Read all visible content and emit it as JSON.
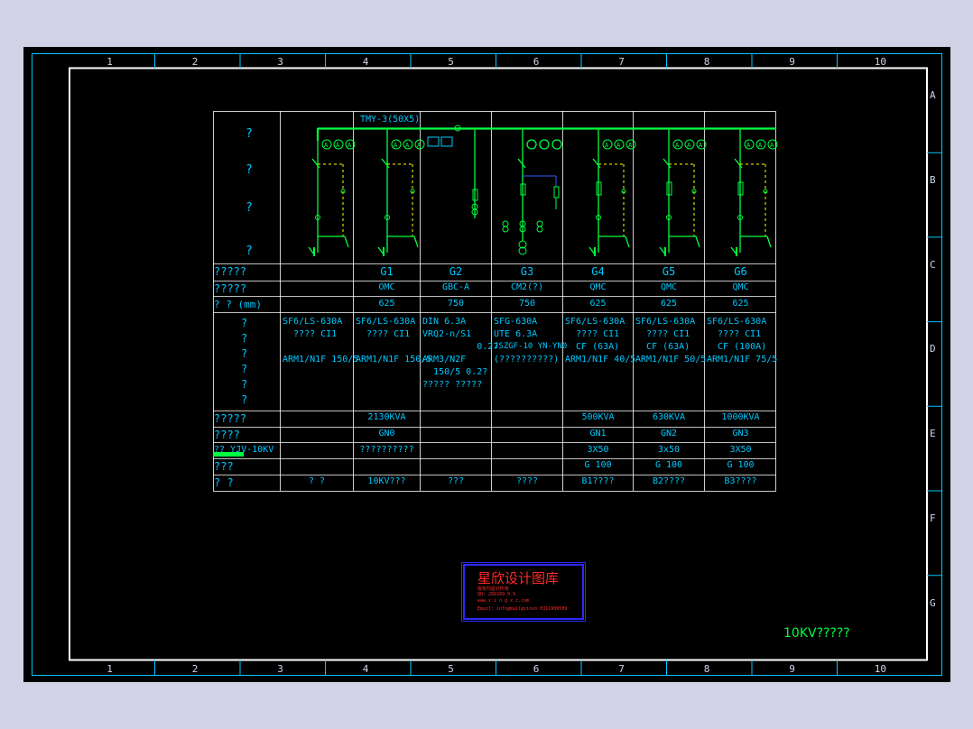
{
  "frame": {
    "columns": [
      "1",
      "2",
      "3",
      "4",
      "5",
      "6",
      "7",
      "8",
      "9",
      "10"
    ],
    "rows": [
      "A",
      "B",
      "C",
      "D",
      "E",
      "F",
      "G"
    ]
  },
  "bus_label": "TMY-3(50X5)",
  "left_labels": {
    "diagram": [
      "?",
      "?",
      "?",
      "?"
    ],
    "r_id": "?????",
    "r_type": "?????",
    "r_size": "?    ? (mm)",
    "r_equip": [
      "?",
      "?",
      "?",
      "?",
      "?",
      "?"
    ],
    "r_cap": "?????",
    "r_circuit": "????",
    "r_cable": "??  YJV-10KV",
    "r_ct": "???",
    "r_note": "?        ?"
  },
  "panels": [
    {
      "id": "",
      "type": "",
      "size": "",
      "equip": [
        "SF6/LS-630A",
        "  ???? CI1",
        "",
        "ARM1/N1F 150/5"
      ],
      "cap": "",
      "circuit": "",
      "cable": "",
      "ct": "",
      "note": "?   ?"
    },
    {
      "id": "G1",
      "type": "OMC",
      "size": "625",
      "equip": [
        "SF6/LS-630A",
        "  ???? CI1",
        "",
        "ARM1/N1F 150/5"
      ],
      "cap": "2130KVA",
      "circuit": "GN0",
      "cable": "??????????",
      "ct": "",
      "note": "10KV???"
    },
    {
      "id": "G2",
      "type": "GBC-A",
      "size": "750",
      "equip": [
        "DIN 6.3A",
        "VRQ2-n/S1",
        "          0.2?",
        "ARM3/N2F",
        "  150/5 0.2?",
        "????? ?????"
      ],
      "cap": "",
      "circuit": "",
      "cable": "",
      "ct": "",
      "note": "???"
    },
    {
      "id": "G3",
      "type": "CM2(?)",
      "size": "750",
      "equip": [
        "SFG-630A",
        "UTE 6.3A",
        "JSZGF-10 YN-YN0",
        "(??????????)"
      ],
      "cap": "",
      "circuit": "",
      "cable": "",
      "ct": "",
      "note": "????"
    },
    {
      "id": "G4",
      "type": "QMC",
      "size": "625",
      "equip": [
        "SF6/LS-630A",
        "  ???? CI1",
        "  CF (63A)",
        "ARM1/N1F 40/5"
      ],
      "cap": "500KVA",
      "circuit": "GN1",
      "cable": "3X50",
      "ct": "G 100",
      "note": "B1????"
    },
    {
      "id": "G5",
      "type": "QMC",
      "size": "625",
      "equip": [
        "SF6/LS-630A",
        "  ???? CI1",
        "  CF (63A)",
        "ARM1/N1F 50/5"
      ],
      "cap": "630KVA",
      "circuit": "GN2",
      "cable": "3x50",
      "ct": "G 100",
      "note": "B2????"
    },
    {
      "id": "G6",
      "type": "QMC",
      "size": "625",
      "equip": [
        "SF6/LS-630A",
        "  ???? CI1",
        "  CF (100A)",
        "ARM1/N1F 75/5"
      ],
      "cap": "1000KVA",
      "circuit": "GN3",
      "cable": "3X50",
      "ct": "G 100",
      "note": "B3????"
    }
  ],
  "stamp": {
    "title": "星欣设计图库",
    "lines": [
      "版权归星欣所有",
      "QQ: 289289 9.9",
      "www.x i n g x c.com",
      "Email: info@mail@xinxn 0311989589"
    ]
  },
  "drawing_title": "10KV?????",
  "colors": {
    "frame": "#ffffff",
    "grid": "#00c8ff",
    "wire": "#00ff40",
    "dash": "#ffff00",
    "stamp": "#ff2a2a",
    "stamp_border": "#2a2aff"
  }
}
